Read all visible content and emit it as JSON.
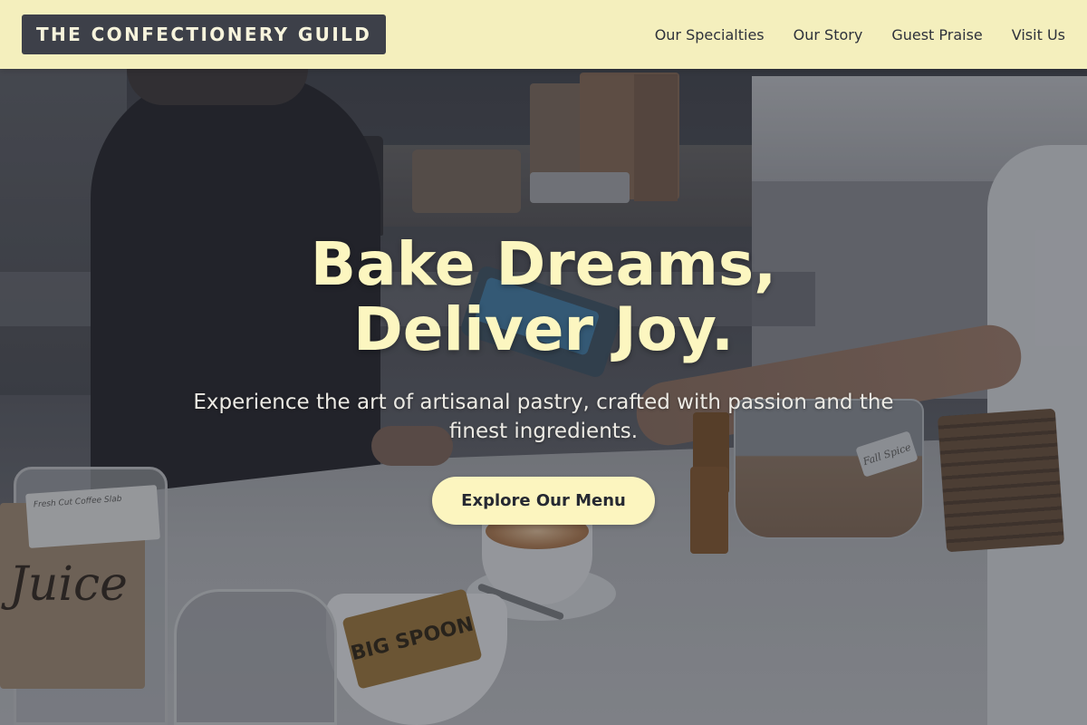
{
  "brand": {
    "name": "THE CONFECTIONERY GUILD"
  },
  "nav": {
    "items": [
      {
        "label": "Our Specialties"
      },
      {
        "label": "Our Story"
      },
      {
        "label": "Guest Praise"
      },
      {
        "label": "Visit Us"
      }
    ]
  },
  "hero": {
    "title_line1": "Bake Dreams,",
    "title_line2": "Deliver Joy.",
    "subtitle": "Experience the art of artisanal pastry, crafted with passion and the finest ingredients.",
    "cta_label": "Explore Our Menu",
    "background_description": "cafe-counter-photo"
  },
  "photo_text": {
    "jar_label": "Fall Spice",
    "packet_label": "BIG SPOON",
    "sign_text": "Juice",
    "tag_text": "Fresh Cut Coffee Slab"
  },
  "colors": {
    "navbar_bg": "#f4efbd",
    "brand_bg": "#3d4049",
    "brand_text": "#f7f4dc",
    "accent_cream": "#fcf6c0",
    "cta_bg": "#fcf5bf",
    "cta_text": "#262932"
  }
}
